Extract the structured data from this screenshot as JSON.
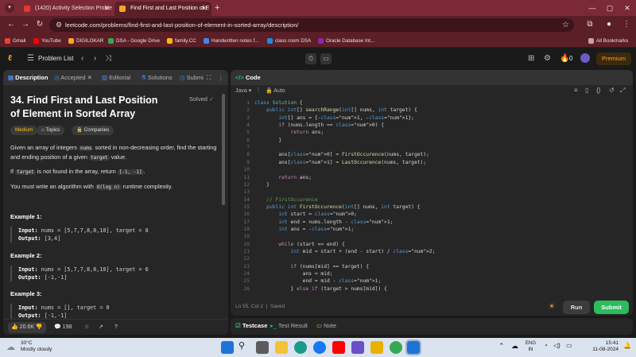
{
  "browser": {
    "tabs": [
      {
        "title": "(1420) Activity Selection Proble",
        "active": false
      },
      {
        "title": "Find First and Last Position of E",
        "active": true
      }
    ],
    "new_tab": "+",
    "url": "leetcode.com/problems/find-first-and-last-position-of-element-in-sorted-array/description/",
    "bookmarks": [
      {
        "label": "Gmail",
        "color": "#ea4335"
      },
      {
        "label": "YouTube",
        "color": "#ff0000"
      },
      {
        "label": "DIGILOKAR",
        "color": "#f5a623"
      },
      {
        "label": "DSA - Google Drive",
        "color": "#34a853"
      },
      {
        "label": "family.CC",
        "color": "#fbbc05"
      },
      {
        "label": "Handwritten notes f...",
        "color": "#4285f4"
      },
      {
        "label": "class room DSA",
        "color": "#1e88e5"
      },
      {
        "label": "Oracle Database Int...",
        "color": "#8e24aa"
      }
    ],
    "all_bookmarks": "All Bookmarks"
  },
  "header": {
    "problem_list": "Problem List",
    "streak": "0",
    "premium": "Premium"
  },
  "left": {
    "tabs": [
      "Description",
      "Accepted",
      "Editorial",
      "Solutions",
      "Submi"
    ],
    "title": "34. Find First and Last Position of Element in Sorted Array",
    "status": "Solved",
    "difficulty": "Medium",
    "topics": "Topics",
    "companies": "Companies",
    "p1_a": "Given an array of integers ",
    "p1_code": "nums",
    "p1_b": " sorted in non-decreasing order, find the starting and ending position of a given ",
    "p1_code2": "target",
    "p1_c": " value.",
    "p2_a": "If ",
    "p2_code": "target",
    "p2_b": " is not found in the array, return ",
    "p2_code2": "[-1, -1]",
    "p2_c": ".",
    "p3_a": "You must write an algorithm with ",
    "p3_code": "O(log n)",
    "p3_b": " runtime complexity.",
    "examples": [
      {
        "heading": "Example 1:",
        "input": "nums = [5,7,7,8,8,10], target = 8",
        "output": "[3,4]"
      },
      {
        "heading": "Example 2:",
        "input": "nums = [5,7,7,8,8,10], target = 6",
        "output": "[-1,-1]"
      },
      {
        "heading": "Example 3:",
        "input": "nums = [], target = 0",
        "output": "[-1,-1]"
      }
    ],
    "input_label": "Input:",
    "output_label": "Output:",
    "likes": "20.6K",
    "comments": "198"
  },
  "code": {
    "title": "Code",
    "language": "Java",
    "autosave": "Auto",
    "lines": [
      "class Solution {",
      "    public int[] searchRange(int[] nums, int target) {",
      "        int[] ans = {-1, -1};",
      "        if (nums.length == 0) {",
      "            return ans;",
      "        }",
      "",
      "        ans[0] = FirstOccurence(nums, target);",
      "        ans[1] = LastOccurence(nums, target);",
      "",
      "        return ans;",
      "    }",
      "",
      "    // FirstOccurence",
      "    public int FirstOccurence(int[] nums, int target) {",
      "        int start = 0;",
      "        int end = nums.length - 1;",
      "        int ans = -1;",
      "",
      "        while (start <= end) {",
      "            int mid = start + (end - start) / 2;",
      "",
      "            if (nums[mid] == target) {",
      "                ans = mid;",
      "                end = mid - 1;",
      "            } else if (target > nums[mid]) {"
    ],
    "cursor": "Ln 55, Col 2",
    "saved": "Saved",
    "run": "Run",
    "submit": "Submit"
  },
  "testpanel": {
    "tabs": [
      "Testcase",
      "Test Result",
      "Note"
    ]
  },
  "taskbar": {
    "temp": "30°C",
    "weather": "Mostly cloudy",
    "lang1": "ENG",
    "lang2": "IN",
    "time": "15:41",
    "date": "11-08-2024"
  }
}
